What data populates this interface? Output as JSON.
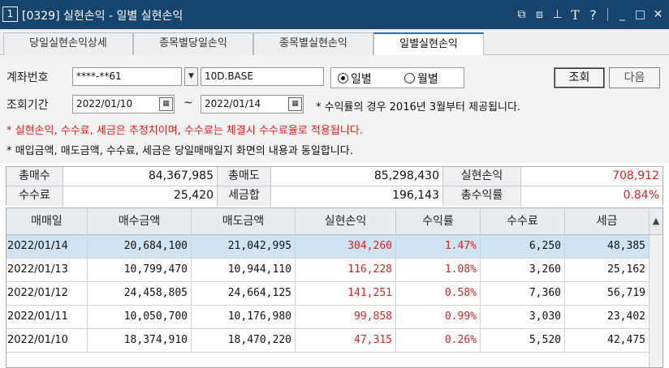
{
  "window": {
    "badge": "1",
    "title": "[0329] 실현손익 - 일별 실현손익",
    "icons": [
      "window-restore-icon",
      "duplicate-window-icon",
      "pin-icon",
      "font-size-icon",
      "help-icon",
      "minimize-icon",
      "maximize-icon",
      "close-icon"
    ],
    "icon_glyphs": {
      "restore": "⧉",
      "duplicate": "⧈",
      "pin": "⊥",
      "font": "T",
      "help": "?",
      "minimize": "_",
      "maximize": "□",
      "close": "✕"
    }
  },
  "tabs": [
    {
      "label": "당일실현손익상세",
      "active": false
    },
    {
      "label": "종목별당일손익",
      "active": false
    },
    {
      "label": "종목별실현손익",
      "active": false
    },
    {
      "label": "일별실현손익",
      "active": true
    }
  ],
  "form": {
    "account_label": "계좌번호",
    "account_value": "****-**61",
    "account_dropdown_glyph": "▼",
    "account_name": "10D.BASE",
    "period_option_daily": "일별",
    "period_option_monthly": "월별",
    "selected_period": "일별",
    "query_button": "조회",
    "next_button": "다음",
    "date_label": "조회기간",
    "start_date": "2022/01/10",
    "tilde": "~",
    "end_date": "2022/01/14",
    "calendar_glyph": "▦",
    "date_note": "* 수익률의 경우 2016년 3월부터 제공됩니다.",
    "warning_note": "* 실현손익, 수수료, 세금은 추정치이며, 수수료는 체결시 수수료율로 적용됩니다.",
    "info_note": "* 매입금액, 매도금액, 수수료, 세금은 당일매매일지 화면의 내용과 동일합니다."
  },
  "summary": {
    "total_buy_label": "총매수",
    "total_buy_value": "84,367,985",
    "total_sell_label": "총매도",
    "total_sell_value": "85,298,430",
    "realized_pnl_label": "실현손익",
    "realized_pnl_value": "708,912",
    "commission_label": "수수료",
    "commission_value": "25,420",
    "tax_total_label": "세금합",
    "tax_total_value": "196,143",
    "total_return_label": "총수익률",
    "total_return_value": "0.84%"
  },
  "grid": {
    "columns": [
      "매매일",
      "매수금액",
      "매도금액",
      "실현손익",
      "수익률",
      "수수료",
      "세금"
    ],
    "scroll_up_glyph": "▲",
    "rows": [
      {
        "date": "2022/01/14",
        "buy": "20,684,100",
        "sell": "21,042,995",
        "pnl": "304,260",
        "rate": "1.47%",
        "commission": "6,250",
        "tax": "48,385",
        "selected": true
      },
      {
        "date": "2022/01/13",
        "buy": "10,799,470",
        "sell": "10,944,110",
        "pnl": "116,228",
        "rate": "1.08%",
        "commission": "3,260",
        "tax": "25,162",
        "selected": false
      },
      {
        "date": "2022/01/12",
        "buy": "24,458,805",
        "sell": "24,664,125",
        "pnl": "141,251",
        "rate": "0.58%",
        "commission": "7,360",
        "tax": "56,719",
        "selected": false
      },
      {
        "date": "2022/01/11",
        "buy": "10,050,700",
        "sell": "10,176,980",
        "pnl": "99,858",
        "rate": "0.99%",
        "commission": "3,030",
        "tax": "23,402",
        "selected": false
      },
      {
        "date": "2022/01/10",
        "buy": "18,374,910",
        "sell": "18,470,220",
        "pnl": "47,315",
        "rate": "0.26%",
        "commission": "5,520",
        "tax": "42,475",
        "selected": false
      }
    ]
  },
  "colors": {
    "title_bar": "#16446e",
    "profit_red": "#e0201e",
    "selected_row": "#cfe3f2"
  }
}
